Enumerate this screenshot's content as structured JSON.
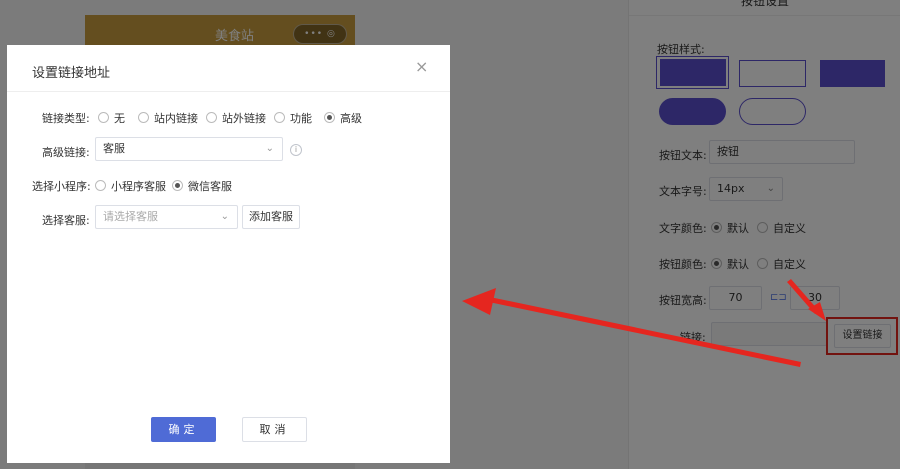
{
  "background": {
    "phone_title": "美食站",
    "capsule_text": "•••  ◎"
  },
  "panel": {
    "title": "按钮设置",
    "button_style_label": "按钮样式:",
    "button_text_label": "按钮文本:",
    "button_text_value": "按钮",
    "font_size_label": "文本字号:",
    "font_size_value": "14px",
    "text_color_label": "文字颜色:",
    "button_color_label": "按钮颜色:",
    "default_option": "默认",
    "custom_option": "自定义",
    "size_label": "按钮宽高:",
    "width_value": "70",
    "height_value": "30",
    "link_label": "链接:",
    "set_link_button": "设置链接",
    "accent_color": "#5b4fce"
  },
  "dialog": {
    "title": "设置链接地址",
    "close_icon": "×",
    "link_type_label": "链接类型:",
    "link_type_options": [
      "无",
      "站内链接",
      "站外链接",
      "功能",
      "高级"
    ],
    "link_type_selected": "高级",
    "advanced_link_label": "高级链接:",
    "advanced_link_value": "客服",
    "info_icon": "i",
    "mini_program_label": "选择小程序:",
    "mini_program_options": [
      "小程序客服",
      "微信客服"
    ],
    "mini_program_selected": "微信客服",
    "service_label": "选择客服:",
    "service_placeholder": "请选择客服",
    "add_service_button": "添加客服",
    "ok_button": "确定",
    "cancel_button": "取消",
    "primary_color": "#4f6bd6"
  },
  "annotation": {
    "arrow_color": "#e5261f"
  }
}
